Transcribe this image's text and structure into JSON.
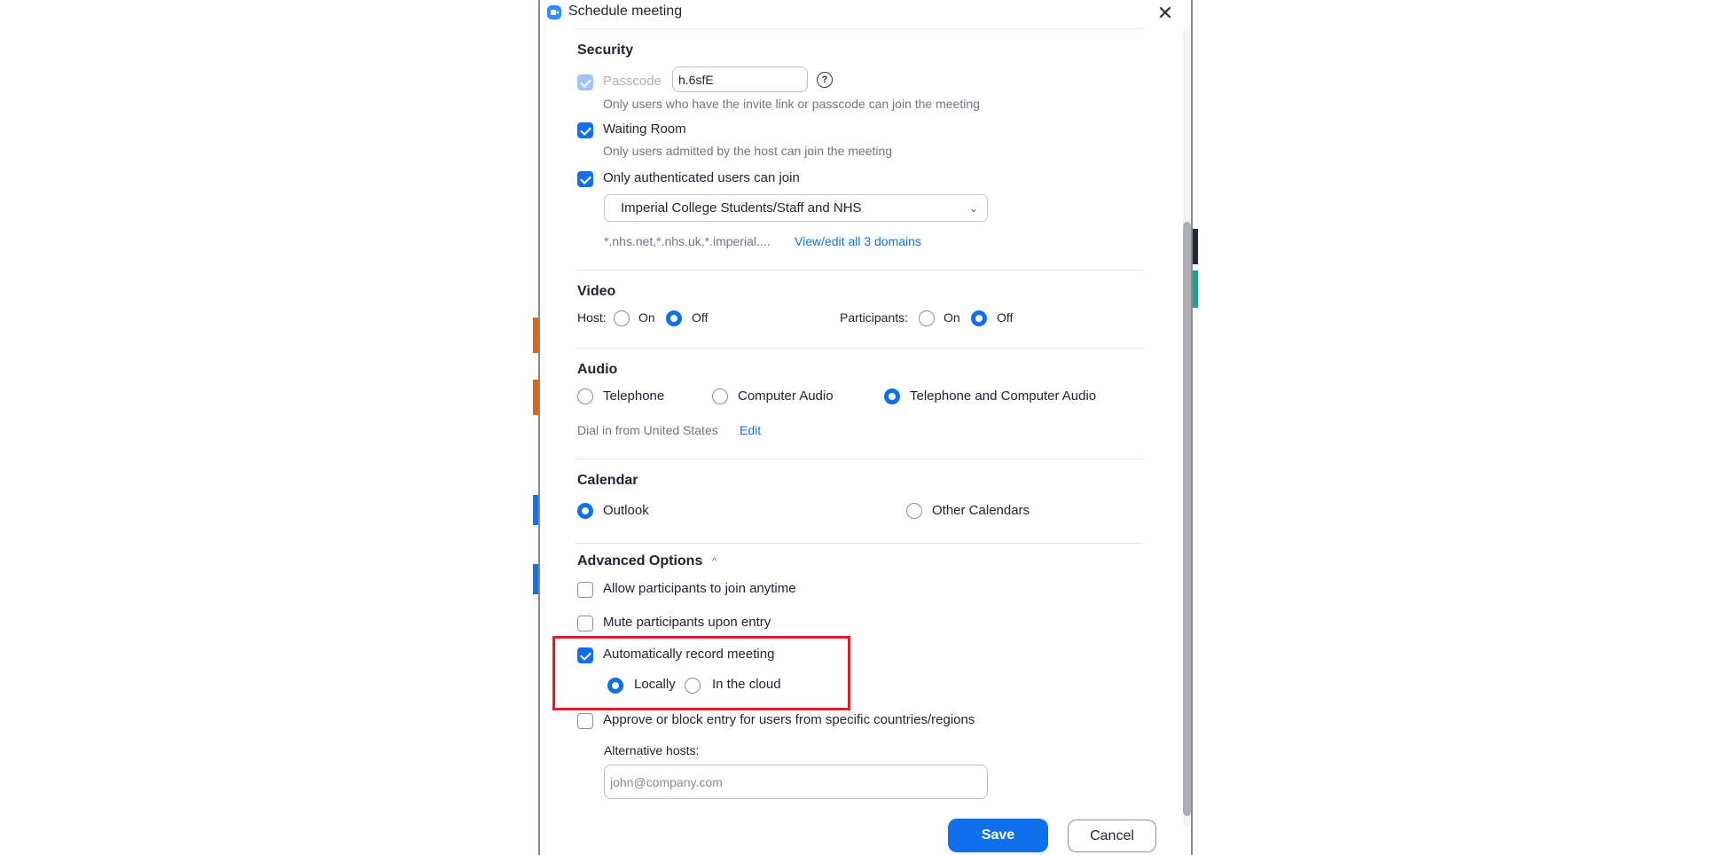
{
  "window": {
    "title": "Schedule meeting",
    "app_icon": "zoom-camera-icon",
    "close_icon": "✕"
  },
  "security": {
    "heading": "Security",
    "passcode": {
      "label": "Passcode",
      "checked": true,
      "disabled": true,
      "value": "h.6sfE",
      "help_icon": "?",
      "hint": "Only users who have the invite link or passcode can join the meeting"
    },
    "waiting_room": {
      "label": "Waiting Room",
      "checked": true,
      "hint": "Only users admitted by the host can join the meeting"
    },
    "authenticated": {
      "label": "Only authenticated users can join",
      "checked": true,
      "selected_option": "Imperial College Students/Staff and NHS",
      "chevron": "⌄",
      "domains_text": "*.nhs.net,*.nhs.uk,*.imperial....",
      "domains_link": "View/edit all 3 domains"
    }
  },
  "video": {
    "heading": "Video",
    "host_label": "Host:",
    "participants_label": "Participants:",
    "on_label": "On",
    "off_label": "Off",
    "host_value": "Off",
    "participants_value": "Off"
  },
  "audio": {
    "heading": "Audio",
    "options": [
      "Telephone",
      "Computer Audio",
      "Telephone and Computer Audio"
    ],
    "selected": "Telephone and Computer Audio",
    "dial_in_text": "Dial in from United States",
    "edit_link": "Edit"
  },
  "calendar": {
    "heading": "Calendar",
    "options": [
      "Outlook",
      "Other Calendars"
    ],
    "selected": "Outlook"
  },
  "advanced": {
    "heading": "Advanced Options",
    "toggle_icon": "^",
    "allow_anytime": {
      "label": "Allow participants to join anytime",
      "checked": false
    },
    "mute_on_entry": {
      "label": "Mute participants upon entry",
      "checked": false
    },
    "auto_record": {
      "label": "Automatically record meeting",
      "checked": true,
      "options": [
        "Locally",
        "In the cloud"
      ],
      "selected": "Locally"
    },
    "approve_block": {
      "label": "Approve or block entry for users from specific countries/regions",
      "checked": false
    },
    "alt_hosts": {
      "label": "Alternative hosts:",
      "placeholder": "john@company.com",
      "value": ""
    }
  },
  "footer": {
    "save_label": "Save",
    "cancel_label": "Cancel"
  },
  "colors": {
    "accent": "#0e71eb",
    "highlight_box": "#e01e2a"
  }
}
